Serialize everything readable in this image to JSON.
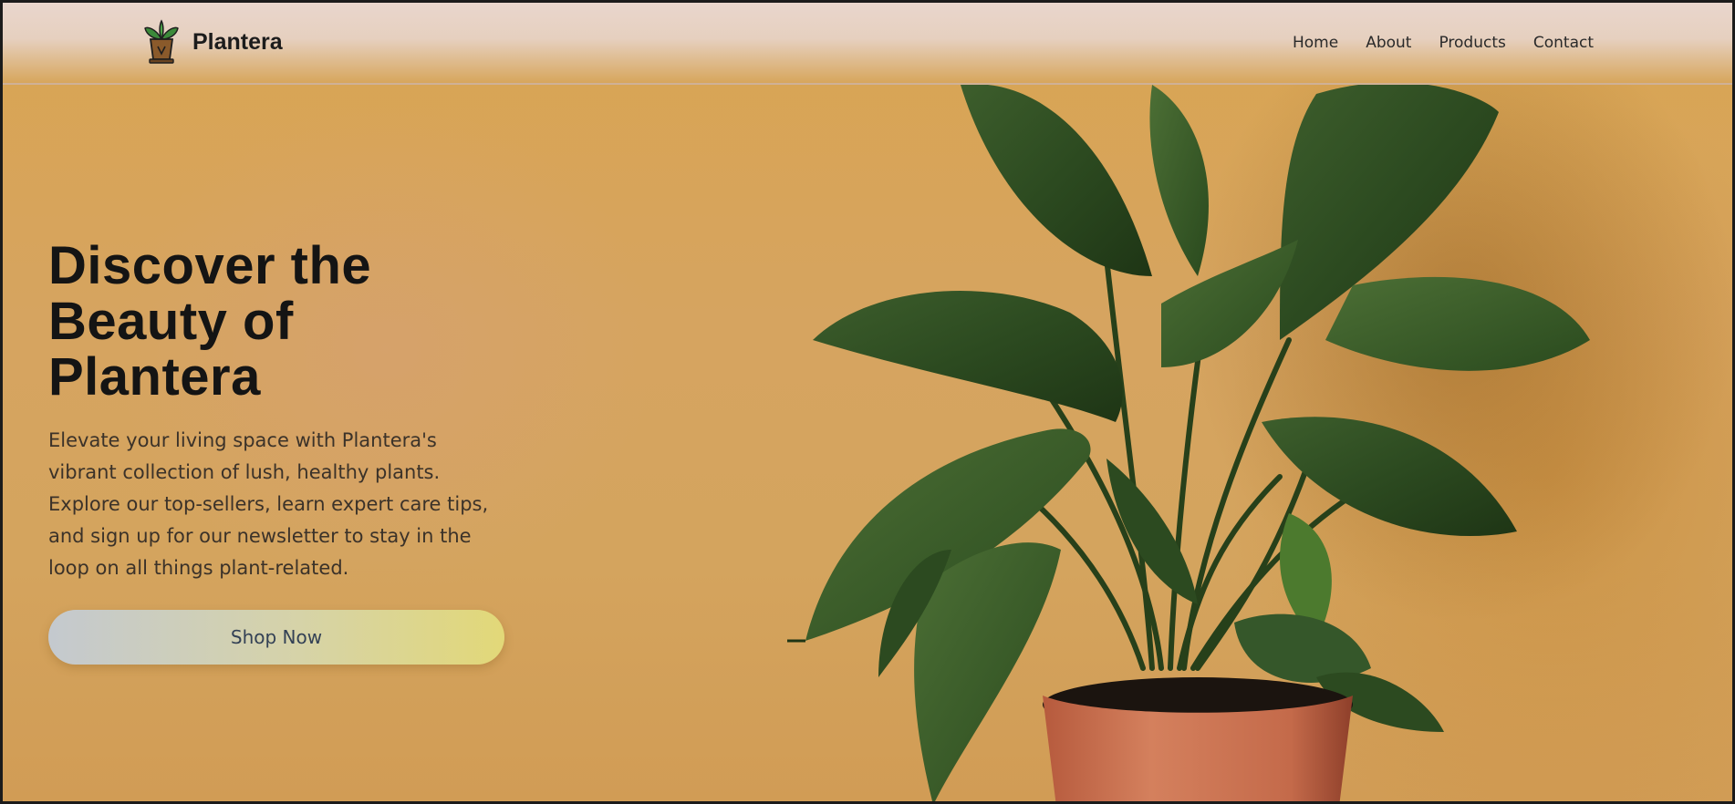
{
  "brand": {
    "name": "Plantera",
    "logo_icon": "potted-plant-icon"
  },
  "nav": {
    "items": [
      {
        "label": "Home"
      },
      {
        "label": "About"
      },
      {
        "label": "Products"
      },
      {
        "label": "Contact"
      }
    ]
  },
  "hero": {
    "title_lines": [
      "Discover the",
      "Beauty of",
      "Plantera"
    ],
    "description_lines": [
      "Elevate your living space with Plantera's",
      "vibrant collection of lush, healthy plants.",
      "Explore our top-sellers, learn expert care tips,",
      "and sign up for our newsletter to stay in the",
      "loop on all things plant-related."
    ],
    "cta_label": "Shop Now",
    "image_icon": "potted-plant-photo"
  },
  "colors": {
    "background": "#d6a460",
    "header": "#e8d4c8",
    "text_dark": "#141414",
    "button_start": "#c4c9cf",
    "button_end": "#e2d878",
    "leaf": "#2f4d22",
    "pot": "#c9704f"
  }
}
